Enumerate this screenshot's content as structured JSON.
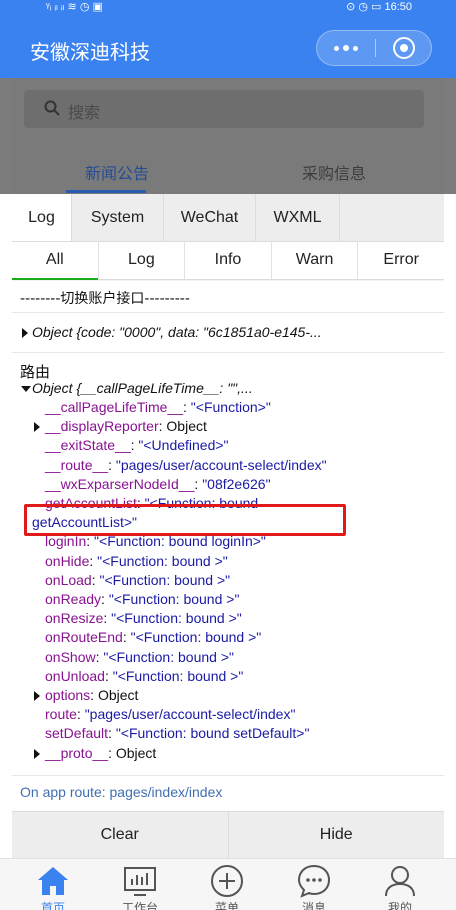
{
  "status_bar": {
    "left": "ᵞᵢ ᵢₗ ᵢₗ ≋ ◷ ▣",
    "right": "⊙ ◷ ▭ 16:50"
  },
  "app": {
    "title": "安徽深迪科技"
  },
  "search": {
    "placeholder": "搜索"
  },
  "page_tabs": [
    {
      "label": "新闻公告"
    },
    {
      "label": "采购信息"
    }
  ],
  "vconsole": {
    "tabs": [
      {
        "label": "Log"
      },
      {
        "label": "System"
      },
      {
        "label": "WeChat"
      },
      {
        "label": "WXML"
      }
    ],
    "subtabs": [
      {
        "label": "All"
      },
      {
        "label": "Log"
      },
      {
        "label": "Info"
      },
      {
        "label": "Warn"
      },
      {
        "label": "Error"
      }
    ],
    "log_1": "--------切换账户接口---------",
    "log_2": "Object {code: \"0000\", data: \"6c1851a0-e145-...",
    "log_3_label": "路由",
    "log_3_head": "Object {__callPageLifeTime__: \"\",...",
    "props": [
      {
        "key": "__callPageLifeTime__",
        "sep": ": ",
        "val": "\"<Function>\"",
        "expandable": false
      },
      {
        "key": "__displayReporter",
        "sep": ": ",
        "val": "Object",
        "expandable": true
      },
      {
        "key": "__exitState__",
        "sep": ": ",
        "val": "\"<Undefined>\"",
        "expandable": false
      },
      {
        "key": "__route__",
        "sep": ": ",
        "val": "\"pages/user/account-select/index\"",
        "expandable": false
      },
      {
        "key": "__wxExparserNodeId__",
        "sep": ": ",
        "val": "\"08f2e626\"",
        "expandable": false
      },
      {
        "key": "getAccountList",
        "sep": ": ",
        "val": "\"<Function: bound",
        "expandable": false
      },
      {
        "key": "",
        "sep": "",
        "val": "getAccountList>\"",
        "expandable": false
      },
      {
        "key": "loginIn",
        "sep": ": ",
        "val": "\"<Function: bound loginIn>\"",
        "expandable": false
      },
      {
        "key": "onHide",
        "sep": ": ",
        "val": "\"<Function: bound >\"",
        "expandable": false
      },
      {
        "key": "onLoad",
        "sep": ": ",
        "val": "\"<Function: bound >\"",
        "expandable": false
      },
      {
        "key": "onReady",
        "sep": ": ",
        "val": "\"<Function: bound >\"",
        "expandable": false
      },
      {
        "key": "onResize",
        "sep": ": ",
        "val": "\"<Function: bound >\"",
        "expandable": false
      },
      {
        "key": "onRouteEnd",
        "sep": ": ",
        "val": "\"<Function: bound >\"",
        "expandable": false
      },
      {
        "key": "onShow",
        "sep": ": ",
        "val": "\"<Function: bound >\"",
        "expandable": false
      },
      {
        "key": "onUnload",
        "sep": ": ",
        "val": "\"<Function: bound >\"",
        "expandable": false
      },
      {
        "key": "options",
        "sep": ": ",
        "val": "Object",
        "expandable": true
      },
      {
        "key": "route",
        "sep": ": ",
        "val": "\"pages/user/account-select/index\"",
        "expandable": false
      },
      {
        "key": "setDefault",
        "sep": ": ",
        "val": "\"<Function: bound setDefault>\"",
        "expandable": false
      },
      {
        "key": "__proto__",
        "sep": ": ",
        "val": "Object",
        "expandable": true
      }
    ],
    "log_4": "On app route: pages/index/index",
    "clear_label": "Clear",
    "hide_label": "Hide"
  },
  "tabbar": [
    {
      "label": "首页",
      "icon": "home-icon",
      "active": true
    },
    {
      "label": "工作台",
      "icon": "workbench-icon",
      "active": false
    },
    {
      "label": "菜单",
      "icon": "plus-circle-icon",
      "active": false
    },
    {
      "label": "消息",
      "icon": "message-icon",
      "active": false
    },
    {
      "label": "我的",
      "icon": "user-icon",
      "active": false
    }
  ],
  "colors": {
    "accent": "#3a82ef",
    "highlight": "#e01a1a",
    "prop_key": "#881391",
    "prop_value": "#1a1aa6"
  }
}
